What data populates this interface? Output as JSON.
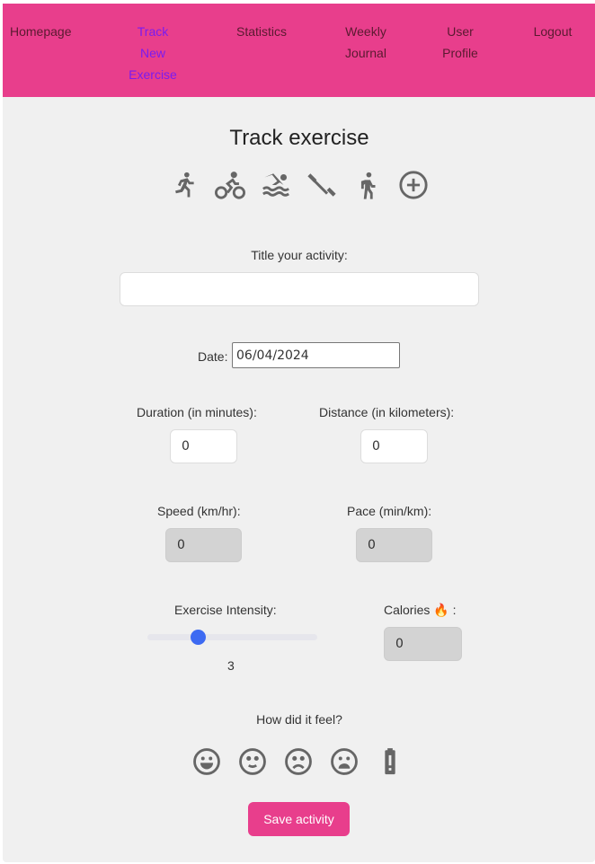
{
  "nav": {
    "items": [
      "Homepage",
      "Track New Exercise",
      "Statistics",
      "Weekly Journal",
      "User Profile",
      "Logout"
    ]
  },
  "page_title": "Track exercise",
  "activity_icons": [
    "running-icon",
    "cycling-icon",
    "swimming-icon",
    "weightlifting-icon",
    "walking-icon",
    "add-circle-icon"
  ],
  "title_label": "Title your activity:",
  "title_value": "",
  "date_label": "Date:",
  "date_value": "06/04/2024",
  "duration_label": "Duration (in minutes):",
  "duration_value": "0",
  "distance_label": "Distance (in kilometers):",
  "distance_value": "0",
  "speed_label": "Speed (km/hr):",
  "speed_value": "0",
  "pace_label": "Pace (min/km):",
  "pace_value": "0",
  "intensity_label": "Exercise Intensity:",
  "intensity_value": "3",
  "intensity_fraction": 0.3,
  "calories_label": "Calories 🔥 :",
  "calories_value": "0",
  "feel_label": "How did it feel?",
  "feel_icons": [
    "very-happy-icon",
    "happy-icon",
    "sad-icon",
    "very-sad-icon",
    "low-battery-icon"
  ],
  "save_label": "Save activity",
  "colors": {
    "brand": "#e83e8c",
    "slider": "#3d6af2"
  }
}
